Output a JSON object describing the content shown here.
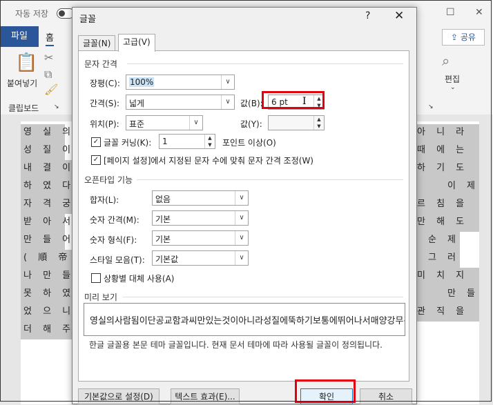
{
  "app": {
    "autosave_label": "자동 저장",
    "tabs": {
      "file": "파일",
      "home": "홈"
    },
    "share": "공유",
    "ribbon": {
      "paste": "붙여넣기",
      "clipboard_group": "클립보드",
      "edit": "편집"
    }
  },
  "dialog": {
    "title": "글꼴",
    "help": "?",
    "close": "✕",
    "tabs": [
      "글꼴(N)",
      "고급(V)"
    ],
    "active_tab": 1,
    "char_spacing": {
      "section": "문자 간격",
      "scale_label": "장평(C):",
      "scale_value": "100%",
      "spacing_label": "간격(S):",
      "spacing_value": "넓게",
      "by_label": "값(B):",
      "by_value": "6 pt",
      "position_label": "위치(P):",
      "position_value": "표준",
      "by2_label": "값(Y):",
      "by2_value": "",
      "kerning_label": "글꼴 커닝(K):",
      "kerning_checked": true,
      "kerning_value": "1",
      "kerning_suffix": "포인트 이상(O)",
      "grid_label": "[페이지 설정]에서 지정된 문자 수에 맞춰 문자 간격 조정(W)",
      "grid_checked": true
    },
    "opentype": {
      "section": "오픈타입 기능",
      "ligatures_label": "합자(L):",
      "ligatures_value": "없음",
      "num_spacing_label": "숫자 간격(M):",
      "num_spacing_value": "기본",
      "num_forms_label": "숫자 형식(F):",
      "num_forms_value": "기본",
      "stylistic_label": "스타일 모음(T):",
      "stylistic_value": "기본값",
      "contextual_label": "상황별 대체 사용(A)",
      "contextual_checked": false
    },
    "preview": {
      "section": "미리 보기",
      "text": "영실의사람됨이단공교함과씨만있는것이아니라성질에뚝하기보통에뛰어나서매양강무관",
      "description": "한글 글꼴용 본문 테마 글꼴입니다. 현재 문서 테마에 따라 사용될 글꼴이 정의됩니다."
    },
    "buttons": {
      "set_default": "기본값으로 설정(D)",
      "text_effects": "텍스트 효과(E)...",
      "ok": "확인",
      "cancel": "취소"
    }
  },
  "document": {
    "left_lines": [
      "영 실 의",
      "성 질 이",
      "내    결 이",
      "하 였 다 .",
      "자 격 궁 루",
      "받 아 서",
      "만 들 어",
      "(  順   帝  )",
      "나    만  들",
      "못 하 였 을",
      "었 으 니",
      "더  해    주"
    ],
    "right_lines": [
      "아 니 라",
      "때 에 는",
      "하 기 도",
      "이 제",
      "르 침 을",
      "만 해 도",
      "순  제",
      "그  러",
      "미 치 지",
      "만  들",
      "관  직 을",
      ""
    ]
  },
  "colors": {
    "highlight_box": "#e00010",
    "file_tab": "#2b579a"
  }
}
